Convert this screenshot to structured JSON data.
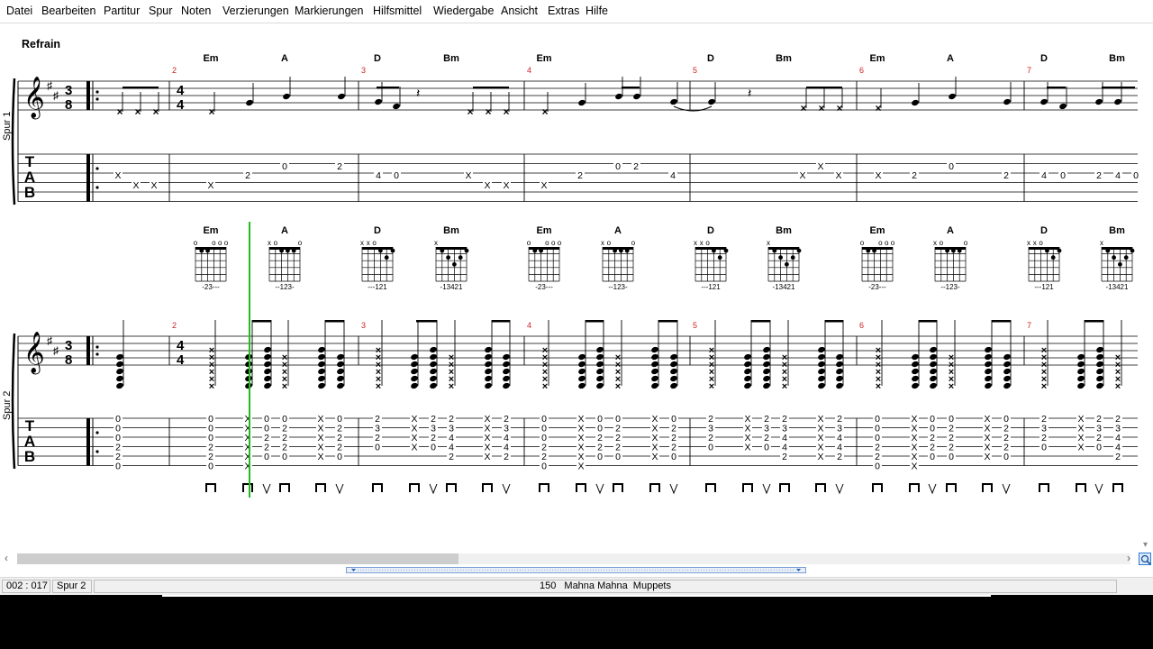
{
  "menu": [
    "Datei",
    "Bearbeiten",
    "Partitur",
    "Spur",
    "Noten",
    "Verzierungen",
    "Markierungen",
    "Hilfsmittel",
    "Wiedergabe",
    "Ansicht",
    "Extras",
    "Hilfe"
  ],
  "score": {
    "section_marker": "Refrain",
    "tracks": [
      "Spur 1",
      "Spur 2"
    ],
    "time_signature_first": [
      "3",
      "8"
    ],
    "time_signature_second": [
      "4",
      "4"
    ],
    "tab_label": [
      "T",
      "A",
      "B"
    ],
    "chords_row1": [
      {
        "name": "Em"
      },
      {
        "name": "A"
      },
      {
        "name": "D"
      },
      {
        "name": "Bm"
      },
      {
        "name": "Em"
      },
      {
        "name": "D"
      },
      {
        "name": "Bm"
      },
      {
        "name": "Em"
      },
      {
        "name": "A"
      },
      {
        "name": "D"
      },
      {
        "name": "Bm"
      }
    ],
    "chords_row2": [
      {
        "name": "Em",
        "fingering": "-23---",
        "open": "o  ooo"
      },
      {
        "name": "A",
        "fingering": "--123-",
        "open": "xo   o"
      },
      {
        "name": "D",
        "fingering": "---121",
        "open": "xxo   "
      },
      {
        "name": "Bm",
        "fingering": "-13421",
        "open": "x     "
      },
      {
        "name": "Em",
        "fingering": "-23---",
        "open": "o  ooo"
      },
      {
        "name": "A",
        "fingering": "--123-",
        "open": "xo   o"
      },
      {
        "name": "D",
        "fingering": "---121",
        "open": "xxo   "
      },
      {
        "name": "Bm",
        "fingering": "-13421",
        "open": "x     "
      },
      {
        "name": "Em",
        "fingering": "-23---",
        "open": "o  ooo"
      },
      {
        "name": "A",
        "fingering": "--123-",
        "open": "xo   o"
      },
      {
        "name": "D",
        "fingering": "---121",
        "open": "xxo   "
      },
      {
        "name": "Bm",
        "fingering": "-13421",
        "open": "x     "
      }
    ],
    "bar_numbers": [
      "2",
      "3",
      "4",
      "5",
      "6",
      "7"
    ],
    "tab1_numbers": [
      "X",
      "X",
      "X",
      "X",
      "2",
      "0",
      "2",
      "4",
      "0",
      "X",
      "X",
      "X",
      "X",
      "2",
      "0",
      "2",
      "4",
      "X",
      "X",
      "X",
      "X",
      "2",
      "0",
      "2",
      "4",
      "0",
      "2",
      "4",
      "0"
    ]
  },
  "status": {
    "position": "002 : 017",
    "track": "Spur 2",
    "tempo": "150",
    "song": "Mahna Mahna",
    "artist": "Muppets"
  },
  "colors": {
    "bar_number": "#cc2222",
    "cursor": "#22bb22",
    "ink": "#000000"
  }
}
